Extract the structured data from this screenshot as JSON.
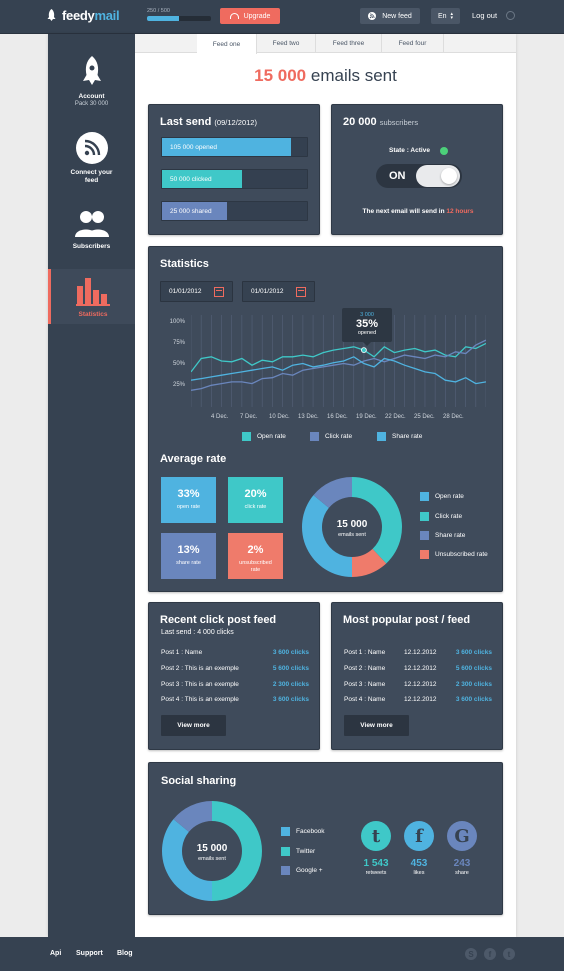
{
  "topbar": {
    "logo_part1": "feedy",
    "logo_part2": "mail",
    "progress_label": "250 / 500",
    "progress_fraction": 0.5,
    "upgrade_label": "Upgrade",
    "newfeed_label": "New feed",
    "lang_label": "En",
    "logout_label": "Log out"
  },
  "sidebar": {
    "items": [
      {
        "label": "Account",
        "sub": "Pack 30 000",
        "icon": "rocket-icon"
      },
      {
        "label": "Connect your feed",
        "icon": "rss-icon"
      },
      {
        "label": "Subscribers",
        "icon": "users-icon"
      },
      {
        "label": "Statistics",
        "icon": "bar-chart-icon"
      }
    ]
  },
  "tabs": [
    "Feed one",
    "Feed two",
    "Feed three",
    "Feed four"
  ],
  "headline": {
    "number": "15 000",
    "text": "emails sent"
  },
  "last_send": {
    "title": "Last send",
    "date": "(09/12/2012)",
    "bars": [
      {
        "label": "105 000 opened",
        "fraction": 0.89,
        "color": "#4fb3e0"
      },
      {
        "label": "50 000 clicked",
        "fraction": 0.55,
        "color": "#3fc8c8"
      },
      {
        "label": "25 000 shared",
        "fraction": 0.45,
        "color": "#6a86bd"
      }
    ]
  },
  "subscribers": {
    "count": "20 000",
    "label": "subscribers",
    "state_label": "State : Active",
    "toggle_label": "ON",
    "next_text": "The next email will send in",
    "next_value": "12 hours"
  },
  "statistics": {
    "title": "Statistics",
    "date_from": "01/01/2012",
    "date_to": "01/01/2012",
    "tooltip": {
      "value": "3 000",
      "pct": "35%",
      "label": "opened"
    },
    "legend": [
      {
        "name": "Open rate",
        "color": "#3fc8c8"
      },
      {
        "name": "Click rate",
        "color": "#6a86bd"
      },
      {
        "name": "Share rate",
        "color": "#4fb3e0"
      }
    ]
  },
  "chart_data": {
    "type": "line",
    "x": [
      "4 Dec.",
      "7 Dec.",
      "10 Dec.",
      "13 Dec.",
      "16 Dec.",
      "19 Dec.",
      "22 Dec.",
      "25 Dec.",
      "28 Dec."
    ],
    "yticks": [
      "100%",
      "75%",
      "50%",
      "25%"
    ],
    "ylim": [
      0,
      110
    ],
    "series": [
      {
        "name": "Open rate",
        "color": "#3fc8c8",
        "values": [
          42,
          58,
          60,
          55,
          54,
          58,
          50,
          56,
          54,
          60,
          60,
          62,
          60,
          65,
          68,
          70,
          72,
          68,
          60,
          72,
          65,
          68,
          70,
          66,
          68,
          62,
          60,
          72,
          70,
          76
        ]
      },
      {
        "name": "Click rate",
        "color": "#6a86bd",
        "values": [
          20,
          22,
          26,
          28,
          30,
          30,
          28,
          34,
          35,
          40,
          38,
          44,
          46,
          48,
          50,
          52,
          50,
          55,
          58,
          54,
          58,
          62,
          60,
          58,
          62,
          60,
          66,
          64,
          74,
          80
        ]
      },
      {
        "name": "Share rate",
        "color": "#4fb3e0",
        "values": [
          32,
          34,
          36,
          38,
          40,
          42,
          44,
          46,
          48,
          44,
          50,
          52,
          48,
          50,
          53,
          55,
          60,
          52,
          48,
          58,
          55,
          50,
          46,
          42,
          40,
          32,
          30,
          35,
          28,
          30
        ]
      }
    ]
  },
  "average_rate": {
    "title": "Average rate",
    "boxes": [
      {
        "pct": "33%",
        "label": "open rate",
        "color": "#4fb3e0"
      },
      {
        "pct": "20%",
        "label": "click rate",
        "color": "#3fc8c8"
      },
      {
        "pct": "13%",
        "label": "share rate",
        "color": "#6a86bd"
      },
      {
        "pct": "2%",
        "label": "unsubscribed rate",
        "color": "#ef7b6b"
      }
    ],
    "donut_value": "15 000",
    "donut_label": "emails sent",
    "donut_slices": [
      {
        "name": "Click rate",
        "value": 38,
        "color": "#3fc8c8"
      },
      {
        "name": "Unsubscribed rate",
        "value": 12,
        "color": "#ef7b6b"
      },
      {
        "name": "Open rate",
        "value": 36,
        "color": "#4fb3e0"
      },
      {
        "name": "Share rate",
        "value": 14,
        "color": "#6a86bd"
      }
    ],
    "legend": [
      {
        "name": "Open rate",
        "color": "#4fb3e0"
      },
      {
        "name": "Click rate",
        "color": "#3fc8c8"
      },
      {
        "name": "Share rate",
        "color": "#6a86bd"
      },
      {
        "name": "Unsubscribed rate",
        "color": "#ef7b6b"
      }
    ]
  },
  "recent": {
    "title": "Recent click post feed",
    "subtitle": "Last send : 4 000 clicks",
    "rows": [
      {
        "name": "Post 1 : Name",
        "clicks": "3 600 clicks"
      },
      {
        "name": "Post 2 : This is an exemple",
        "clicks": "5 600 clicks"
      },
      {
        "name": "Post 3 : This is an exemple",
        "clicks": "2 300 clicks"
      },
      {
        "name": "Post 4 : This is an exemple",
        "clicks": "3 600 clicks"
      }
    ],
    "button": "View more"
  },
  "popular": {
    "title": "Most popular post / feed",
    "rows": [
      {
        "name": "Post 1 : Name",
        "date": "12.12.2012",
        "clicks": "3 600 clicks"
      },
      {
        "name": "Post 2 : Name",
        "date": "12.12.2012",
        "clicks": "5 600 clicks"
      },
      {
        "name": "Post 3 : Name",
        "date": "12.12.2012",
        "clicks": "2 300 clicks"
      },
      {
        "name": "Post 4 : Name",
        "date": "12.12.2012",
        "clicks": "3 600 clicks"
      }
    ],
    "button": "View more"
  },
  "social": {
    "title": "Social sharing",
    "donut_value": "15 000",
    "donut_label": "emails sent",
    "donut_slices": [
      {
        "name": "Twitter",
        "value": 50,
        "color": "#3fc8c8"
      },
      {
        "name": "Facebook",
        "value": 36,
        "color": "#4fb3e0"
      },
      {
        "name": "Google +",
        "value": 14,
        "color": "#6a86bd"
      }
    ],
    "legend": [
      {
        "name": "Facebook",
        "color": "#4fb3e0"
      },
      {
        "name": "Twitter",
        "color": "#3fc8c8"
      },
      {
        "name": "Google +",
        "color": "#6a86bd"
      }
    ],
    "stats": [
      {
        "glyph": "t",
        "value": "1 543",
        "label": "retweets",
        "color": "#3fc8c8",
        "icon": "tumblr-icon"
      },
      {
        "glyph": "f",
        "value": "453",
        "label": "likes",
        "color": "#4fb3e0",
        "icon": "facebook-icon"
      },
      {
        "glyph": "G",
        "value": "243",
        "label": "share",
        "color": "#6a86bd",
        "icon": "google-icon"
      }
    ]
  },
  "footer": {
    "links": [
      "Api",
      "Support",
      "Blog"
    ],
    "icons": [
      "S",
      "f",
      "t"
    ]
  }
}
